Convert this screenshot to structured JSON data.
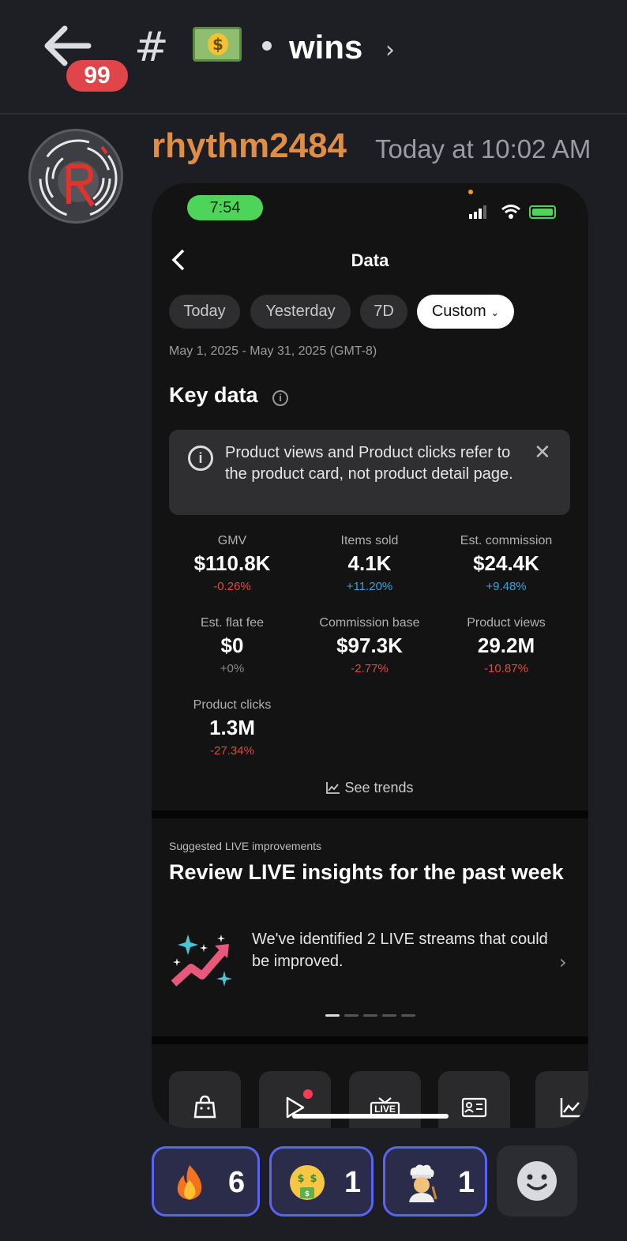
{
  "header": {
    "unread_count": "99",
    "hash": "#",
    "channel_emoji": "money-bag-bill",
    "channel_name": "wins",
    "chevron": "›"
  },
  "message": {
    "username": "rhythm2484",
    "timestamp": "Today at 10:02 AM",
    "username_color": "#e08e45"
  },
  "phone": {
    "status_time": "7:54",
    "page_title": "Data",
    "date_chips": [
      {
        "label": "Today"
      },
      {
        "label": "Yesterday"
      },
      {
        "label": "7D"
      },
      {
        "label": "Custom"
      }
    ],
    "date_range": "May 1, 2025 - May 31, 2025 (GMT-8)",
    "key_data_title": "Key data",
    "notice_text": "Product views and Product clicks refer to the product card, not product detail page.",
    "metrics": [
      {
        "label": "GMV",
        "value": "$110.8K",
        "delta": "-0.26%"
      },
      {
        "label": "Items sold",
        "value": "4.1K",
        "delta": "+11.20%"
      },
      {
        "label": "Est. commission",
        "value": "$24.4K",
        "delta": "+9.48%"
      },
      {
        "label": "Est. flat fee",
        "value": "$0",
        "delta": "+0%"
      },
      {
        "label": "Commission base",
        "value": "$97.3K",
        "delta": "-2.77%"
      },
      {
        "label": "Product views",
        "value": "29.2M",
        "delta": "-10.87%"
      },
      {
        "label": "Product clicks",
        "value": "1.3M",
        "delta": "-27.34%"
      }
    ],
    "see_trends": "See trends",
    "suggest_label": "Suggested LIVE improvements",
    "review_title": "Review LIVE insights for the past week",
    "review_desc": "We've identified 2 LIVE streams that could be improved.",
    "carousel_pages": 5,
    "carousel_active": 1,
    "tiles": [
      "shopping-bag-icon",
      "video-play-icon",
      "live-tv-icon",
      "id-card-icon",
      "trend-chart-icon"
    ],
    "tile_live_text": "LIVE"
  },
  "reactions": [
    {
      "emoji": "fire",
      "count": "6"
    },
    {
      "emoji": "money-mouth-face",
      "count": "1"
    },
    {
      "emoji": "cook",
      "count": "1"
    }
  ],
  "colors": {
    "negative": "#e0473d",
    "positive": "#3aa1d7",
    "accent": "#5865f2"
  }
}
